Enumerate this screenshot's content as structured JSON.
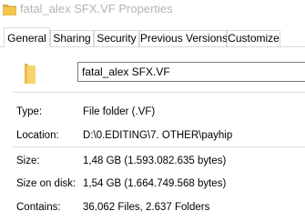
{
  "window": {
    "title": "fatal_alex SFX.VF Properties"
  },
  "tabs": [
    {
      "label": "General",
      "active": true
    },
    {
      "label": "Sharing",
      "active": false
    },
    {
      "label": "Security",
      "active": false
    },
    {
      "label": "Previous Versions",
      "active": false
    },
    {
      "label": "Customize",
      "active": false
    }
  ],
  "general": {
    "name_value": "fatal_alex SFX.VF",
    "rows": [
      {
        "label": "Type:",
        "value": "File folder (.VF)"
      },
      {
        "label": "Location:",
        "value": "D:\\0.EDITING\\7. OTHER\\payhip"
      },
      {
        "label": "Size:",
        "value": "1,48 GB (1.593.082.635 bytes)"
      },
      {
        "label": "Size on disk:",
        "value": "1,54 GB (1.664.749.568 bytes)"
      },
      {
        "label": "Contains:",
        "value": "36.062 Files, 2.637 Folders"
      }
    ]
  },
  "icons": {
    "title_icon": "folder-icon",
    "large_icon": "folder-icon"
  },
  "colors": {
    "title_inactive": "#b4b4b4",
    "folder_yellow": "#f5c64a",
    "border": "#d9d9d9"
  }
}
